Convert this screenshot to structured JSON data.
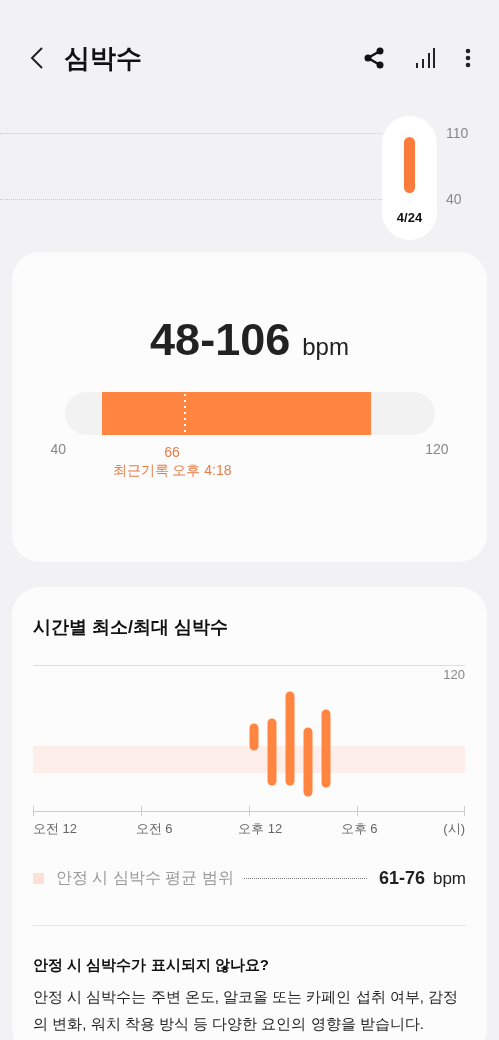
{
  "header": {
    "title": "심박수"
  },
  "trend": {
    "y_labels": [
      "110",
      "40"
    ],
    "days": [
      {
        "label": "4/24",
        "selected": true
      }
    ]
  },
  "summary": {
    "value": "48-106",
    "unit": "bpm",
    "scale_min": "40",
    "scale_max": "120",
    "latest_value": "66",
    "latest_caption": "최근기록 오후 4:18"
  },
  "hourly": {
    "title": "시간별 최소/최대 심박수",
    "y_label": "120",
    "x_labels": [
      "오전 12",
      "오전 6",
      "오후 12",
      "오후 6"
    ],
    "x_unit": "(시)",
    "legend": {
      "label": "안정 시 심박수 평균 범위",
      "value": "61-76",
      "unit": "bpm"
    },
    "help": {
      "question": "안정 시 심박수가 표시되지 않나요?",
      "answer": "안정 시 심박수는 주변 온도, 알코올 또는 카페인 섭취 여부, 감정의 변화, 워치 착용 방식 등 다양한 요인의 영향을 받습니다."
    }
  }
}
